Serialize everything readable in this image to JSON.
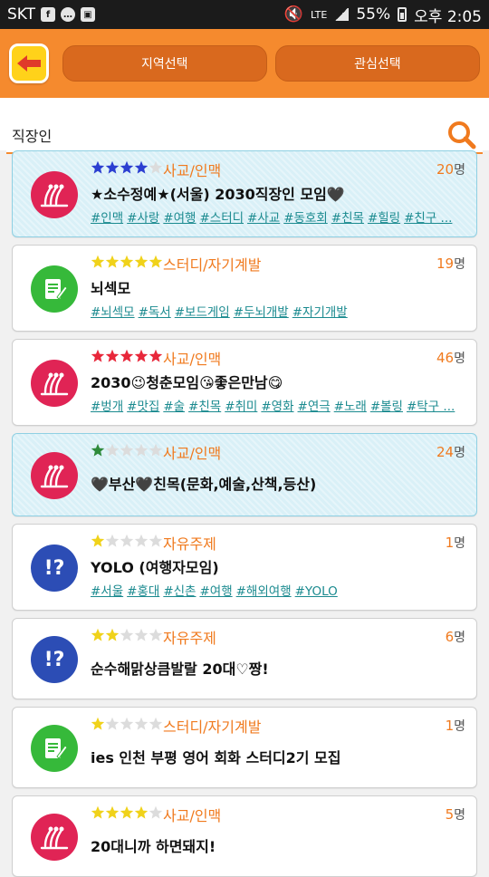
{
  "status_bar": {
    "carrier": "SKT",
    "battery": "55%",
    "time": "오후 2:05",
    "network": "LTE"
  },
  "header": {
    "back_icon": "arrow-left-icon",
    "region_button": "지역선택",
    "interest_button": "관심선택",
    "colors": {
      "bar": "#f58a2e",
      "button": "#d9691e",
      "back": "#ffd21a"
    }
  },
  "search": {
    "value": "직장인",
    "icon": "search-icon"
  },
  "groups": [
    {
      "stars": 4,
      "star_color": "#2c3fd1",
      "category": "사교/인맥",
      "members": "20",
      "unit": "명",
      "title": "★소수정예★(서울) 2030직장인 모임🖤",
      "tags": [
        "#인맥",
        "#사랑",
        "#여행",
        "#스터디",
        "#사교",
        "#동호회",
        "#친목",
        "#힐링",
        "#친구 ..."
      ],
      "highlight": true,
      "type": "social"
    },
    {
      "stars": 5,
      "star_color": "#f0d21a",
      "category": "스터디/자기계발",
      "members": "19",
      "unit": "명",
      "title": "뇌섹모",
      "tags": [
        "#뇌섹모",
        "#독서",
        "#보드게임",
        "#두뇌개발",
        "#자기개발"
      ],
      "highlight": false,
      "type": "study"
    },
    {
      "stars": 5,
      "star_color": "#e8273a",
      "category": "사교/인맥",
      "members": "46",
      "unit": "명",
      "title": "2030😉청춘모임😘좋은만남😋",
      "tags": [
        "#벙개",
        "#맛집",
        "#술",
        "#친목",
        "#취미",
        "#영화",
        "#연극",
        "#노래",
        "#볼링",
        "#탁구 ..."
      ],
      "highlight": false,
      "type": "social"
    },
    {
      "stars": 1,
      "star_color": "#2e8a3a",
      "category": "사교/인맥",
      "members": "24",
      "unit": "명",
      "title": "🖤부산🖤친목(문화,예술,산책,등산)",
      "tags": [],
      "highlight": true,
      "type": "social"
    },
    {
      "stars": 1,
      "star_color": "#f0d21a",
      "category": "자유주제",
      "members": "1",
      "unit": "명",
      "title": "YOLO (여행자모임)",
      "tags": [
        "#서울",
        "#홍대",
        "#신촌",
        "#여행",
        "#해외여행",
        "#YOLO"
      ],
      "highlight": false,
      "type": "free"
    },
    {
      "stars": 2,
      "star_color": "#f0d21a",
      "category": "자유주제",
      "members": "6",
      "unit": "명",
      "title": "순수해맑상큼발랄 20대♡짱!",
      "tags": [],
      "highlight": false,
      "type": "free"
    },
    {
      "stars": 1,
      "star_color": "#f0d21a",
      "category": "스터디/자기계발",
      "members": "1",
      "unit": "명",
      "title": "ies 인천 부평 영어 회화 스터디2기 모집",
      "tags": [],
      "highlight": false,
      "type": "study"
    },
    {
      "stars": 4,
      "star_color": "#f0d21a",
      "category": "사교/인맥",
      "members": "5",
      "unit": "명",
      "title": "20대니까 하면돼지!",
      "tags": [],
      "highlight": false,
      "type": "social"
    }
  ]
}
